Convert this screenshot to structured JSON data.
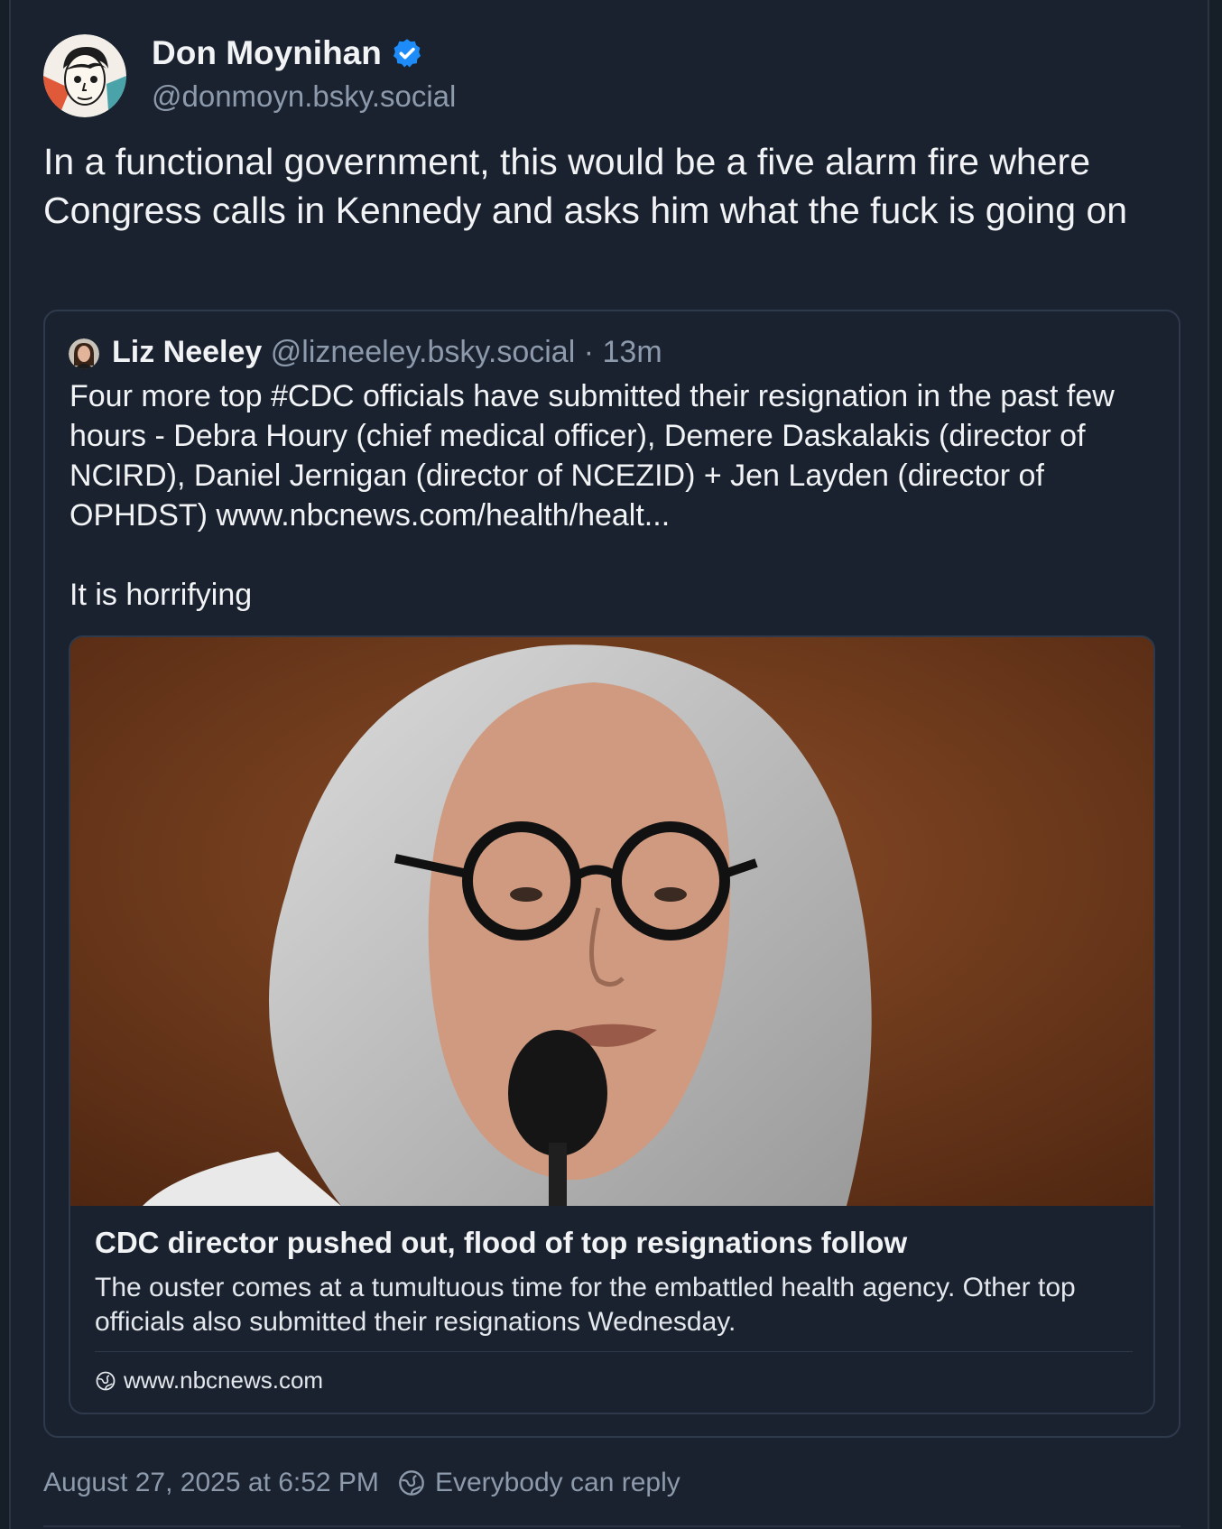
{
  "post": {
    "author_name": "Don Moynihan",
    "author_handle": "@donmoyn.bsky.social",
    "text": "In a functional government, this would be a five alarm fire where Congress calls in Kennedy and asks him what the fuck is going on",
    "timestamp": "August 27, 2025 at 6:52 PM",
    "reply_setting": "Everybody can reply"
  },
  "quote": {
    "author_name": "Liz Neeley",
    "author_handle": "@lizneeley.bsky.social",
    "separator": "·",
    "time_ago": "13m",
    "paragraph_1": "Four more top #CDC officials have submitted their resignation in the past few hours - Debra Houry (chief medical officer), Demere Daskalakis (director of NCIRD), Daniel Jernigan (director of NCEZID) + Jen Layden (director of OPHDST) www.nbcnews.com/health/healt...",
    "paragraph_2": "It is horrifying",
    "link_card": {
      "title": "CDC director pushed out, flood of top resignations follow",
      "description": "The ouster comes at a tumultuous time for the embattled health agency. Other top officials also submitted their resignations Wednesday.",
      "domain": "www.nbcnews.com"
    }
  },
  "colors": {
    "background": "#1a2230",
    "text_primary": "#f1f3f5",
    "text_secondary": "#8d9aab",
    "border": "#2e3a4b",
    "verified_badge": "#1d8cf8"
  },
  "icons": {
    "verified": "verified-check-icon",
    "globe": "globe-icon",
    "reply": "earth-reply-icon"
  }
}
